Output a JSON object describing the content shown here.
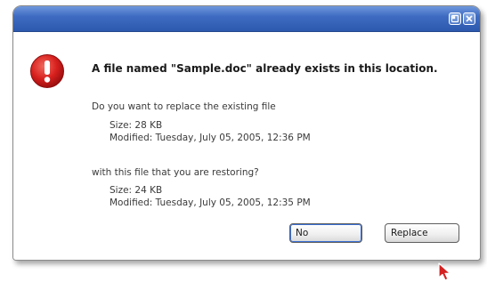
{
  "dialog": {
    "title_buttons": [
      "help-icon",
      "close-icon"
    ],
    "icon": "warning-exclamation-icon",
    "heading": "A file named \"Sample.doc\" already exists in this location.",
    "question": "Do you want to replace the existing file",
    "existing": {
      "size": "Size: 28 KB",
      "modified": "Modified: Tuesday, July 05, 2005, 12:36 PM"
    },
    "restoring_question": "with this file that you are restoring?",
    "restoring": {
      "size": "Size: 24 KB",
      "modified": "Modified: Tuesday, July 05, 2005, 12:35 PM"
    },
    "buttons": {
      "no": "No",
      "replace": "Replace"
    }
  },
  "colors": {
    "titlebar": "#3f6cc2",
    "warning_red": "#d7201e",
    "focus_ring": "#3b6fd4",
    "cursor_red": "#d42020"
  }
}
